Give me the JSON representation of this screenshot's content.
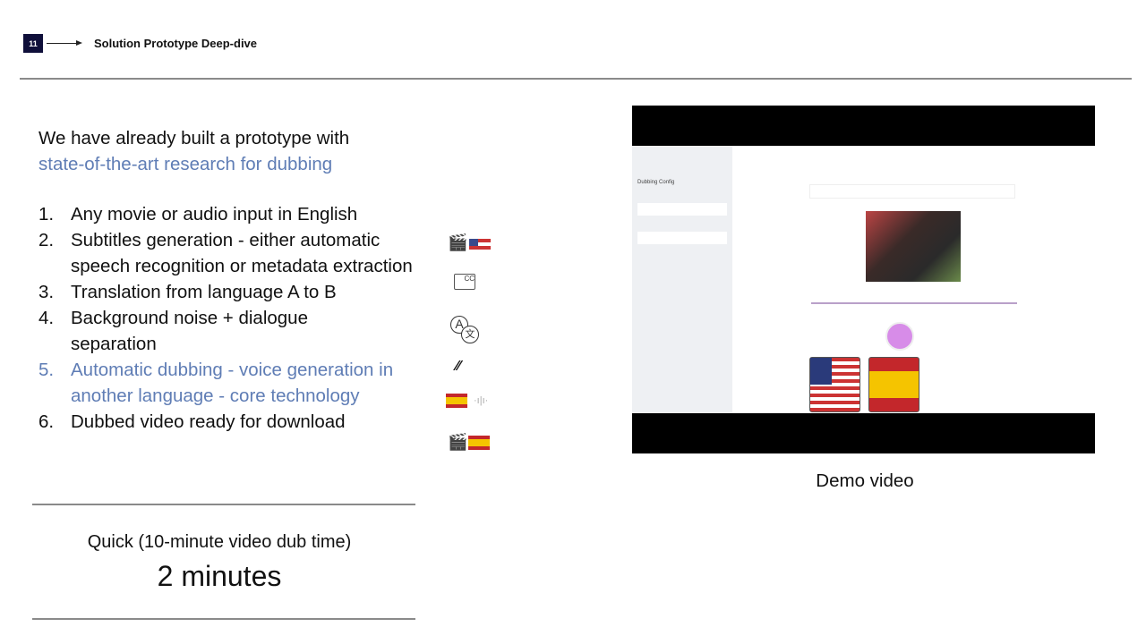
{
  "header": {
    "slide_number": "11",
    "title": "Solution Prototype Deep-dive"
  },
  "intro": {
    "line1": "We have already built a prototype with",
    "line2": "state-of-the-art research for dubbing"
  },
  "steps": [
    {
      "num": "1.",
      "text": "Any movie or audio input in English",
      "highlight": false,
      "icons": [
        "clapperboard-icon",
        "us-flag-icon"
      ]
    },
    {
      "num": "2.",
      "text": "Subtitles generation - either automatic speech recognition or metadata extraction",
      "highlight": false,
      "icons": [
        "subtitles-icon"
      ]
    },
    {
      "num": "3.",
      "text": "Translation from language A to B",
      "highlight": false,
      "icons": [
        "translate-icon"
      ]
    },
    {
      "num": "4.",
      "text": "Background noise + dialogue separation",
      "highlight": false,
      "icons": [
        "waveform-split-icon"
      ]
    },
    {
      "num": "5.",
      "text": "Automatic dubbing - voice generation in another language - core technology",
      "highlight": true,
      "icons": [
        "spain-flag-icon",
        "voice-wave-icon"
      ]
    },
    {
      "num": "6.",
      "text": "Dubbed video ready for download",
      "highlight": false,
      "icons": [
        "clapperboard-icon",
        "spain-flag-icon"
      ]
    }
  ],
  "video": {
    "caption": "Demo video",
    "sidebar_title": "Dubbing Config"
  },
  "metric": {
    "label": "Quick (10-minute video dub time)",
    "value": "2 minutes"
  },
  "colors": {
    "accent": "#5f7db5",
    "rule": "#8a8a8a",
    "number_box": "#0f0f3a"
  }
}
